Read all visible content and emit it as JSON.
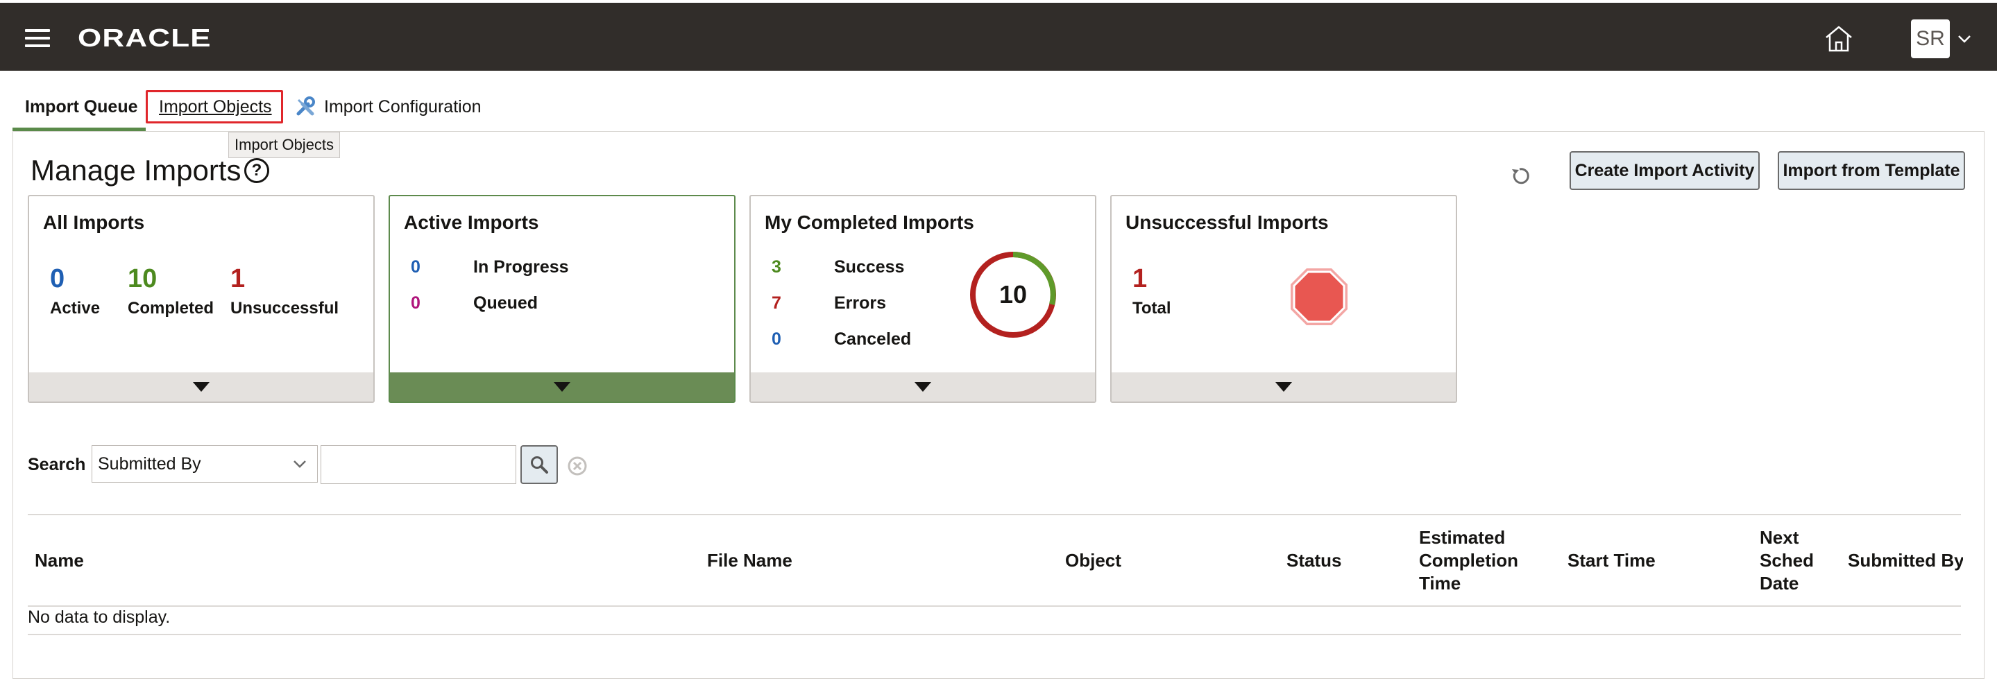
{
  "header": {
    "logo_text": "ORACLE",
    "avatar_initials": "SR"
  },
  "tabs": [
    {
      "label": "Import Queue",
      "selected": true
    },
    {
      "label": "Import Objects"
    },
    {
      "label": "Import Configuration"
    }
  ],
  "tooltip": "Import Objects",
  "page": {
    "title": "Manage Imports",
    "help_glyph": "?",
    "buttons": {
      "create": "Create Import Activity",
      "template": "Import from Template"
    }
  },
  "cards": {
    "all": {
      "title": "All Imports",
      "stats": [
        {
          "value": "0",
          "label": "Active",
          "color": "#1f5fb3"
        },
        {
          "value": "10",
          "label": "Completed",
          "color": "#4d8a1f"
        },
        {
          "value": "1",
          "label": "Unsuccessful",
          "color": "#b3211f"
        }
      ]
    },
    "active": {
      "title": "Active Imports",
      "rows": [
        {
          "value": "0",
          "label": "In Progress",
          "color": "#1f5fb3"
        },
        {
          "value": "0",
          "label": "Queued",
          "color": "#b0157c"
        }
      ]
    },
    "completed": {
      "title": "My Completed Imports",
      "rows": [
        {
          "value": "3",
          "label": "Success",
          "color": "#4d8a1f"
        },
        {
          "value": "7",
          "label": "Errors",
          "color": "#b3211f"
        },
        {
          "value": "0",
          "label": "Canceled",
          "color": "#1f5fb3"
        }
      ],
      "donut_total": "10"
    },
    "unsuccessful": {
      "title": "Unsuccessful Imports",
      "value": "1",
      "label": "Total"
    }
  },
  "search": {
    "label": "Search",
    "field_selected": "Submitted By",
    "query": ""
  },
  "table": {
    "columns": [
      "Name",
      "File Name",
      "Object",
      "Status",
      "Estimated Completion Time",
      "Start Time",
      "Next Sched Date",
      "Submitted By"
    ],
    "empty_text": "No data to display."
  }
}
